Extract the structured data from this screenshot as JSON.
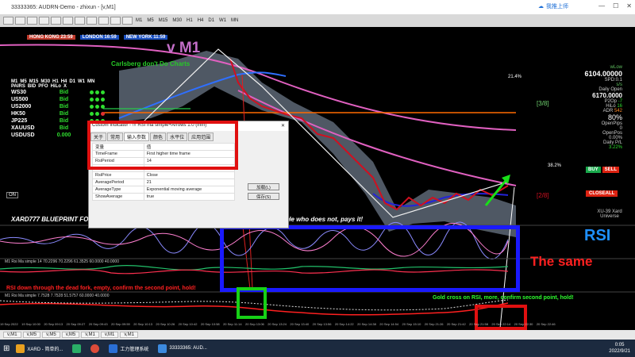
{
  "window": {
    "title": "33333365: AUDRN-Demo - zhixun - [v,M1]",
    "cloud_label": "我推上师"
  },
  "toolbar": {
    "timeframes": [
      "M1",
      "M5",
      "M15",
      "M30",
      "H1",
      "H4",
      "D1",
      "W1",
      "MN"
    ]
  },
  "sessions": [
    {
      "label": "HONG KONG 23:59"
    },
    {
      "label": "LONDON 16:59"
    },
    {
      "label": "NEW YORK 11:59"
    }
  ],
  "chart": {
    "overlay_title": "v M1",
    "carlsberg_text": "Carlsberg don't Do Charts",
    "blueprint_text": "XARD777 BLUEPRINT FOR SUCCESS  ROBWT  ONE INTEREST  He who orders it , earns it... He who does not, pays it!",
    "level_3_8": "[3/8]",
    "level_2_8": "[2/8]",
    "fib_21": "21.4%",
    "fib_38": "38.2%",
    "on_label": "ON",
    "rsi_label": "RSI",
    "same_label": "The same",
    "gold_label": "Gold cross on RSI, more, confirm second point, hold!",
    "down_label": "RSI down through the dead fork, empty, confirm the second point, hold!",
    "sub1_label": "M1 Rsi Ma simple 14 70.2296 70.2296 61.3525 60.0000 40.0000",
    "sub2_label": "M1 Rsi Ma simple 7.7528 7.7528 51.5757 60.0000 40.0000",
    "xard_universe": "XU-39 Xard Universe",
    "time_labels": [
      "19 Sep 2022",
      "19 Sep 10:00",
      "20 Sep 09:13",
      "20 Sep 09:27",
      "20 Sep 09:43",
      "20 Sep 09:59",
      "20 Sep 10:13",
      "20 Sep 10:26",
      "20 Sep 10:42",
      "20 Sep 10:58",
      "20 Sep 11:14",
      "20 Sep 13:06",
      "20 Sep 13:24",
      "20 Sep 13:40",
      "20 Sep 13:56",
      "20 Sep 14:22",
      "20 Sep 14:38",
      "20 Sep 14:54",
      "20 Sep 15:10",
      "20 Sep 21:26",
      "20 Sep 21:42",
      "20 Sep 21:58",
      "20 Sep 22:14",
      "20 Sep 22:30",
      "20 Sep 22:46"
    ]
  },
  "symbol_table": {
    "header": [
      "M1",
      "M5",
      "M15",
      "M30",
      "H1",
      "H4",
      "D1",
      "W1",
      "MN"
    ],
    "row_labels": [
      "PAIRS",
      "BID",
      "PFO",
      "HiLo",
      "X"
    ],
    "rows": [
      {
        "symbol": "WS30",
        "bid": "Bid"
      },
      {
        "symbol": "US500",
        "bid": "Bid"
      },
      {
        "symbol": "US2000",
        "bid": "Bid"
      },
      {
        "symbol": "HK50",
        "bid": "Bid"
      },
      {
        "symbol": "JP225",
        "bid": "Bid"
      },
      {
        "symbol": "XAUUSD",
        "bid": "Bid"
      },
      {
        "symbol": "USDUSD",
        "bid": "0.000"
      }
    ]
  },
  "right_panel": {
    "wlow": "wLow",
    "price": "6104.00000",
    "spd": "SPD:0.1",
    "spd2": "s/s",
    "daily_open_label": "Daily Open",
    "daily_open": "6170.0000",
    "p2op_label": "P2Op",
    "p2op": "-7",
    "hilo_label": "HiLo",
    "hilo": "16",
    "adr_label": "ADR",
    "adr": "542",
    "percent": "80%",
    "openpips_label": "OpenPips",
    "openpips": "0",
    "openpos_label": "OpenPos",
    "openpos": "0.00%",
    "daily_pl_label": "Daily P/L",
    "daily_pl": "3.22%",
    "buy": "BUY",
    "sell": "SELL",
    "closeall": "CLOSEALL"
  },
  "dialog": {
    "title": "Custom Indicator - !!! RSI ma simple+Arrows 1.0 (mm)",
    "tabs": [
      "关于",
      "常用",
      "输入参数",
      "颜色",
      "水平位",
      "应用范围"
    ],
    "columns": [
      "变量",
      "值"
    ],
    "params": [
      {
        "name": "TimeFrame",
        "value": "First higher time frame"
      },
      {
        "name": "RsiPeriod",
        "value": "14"
      },
      {
        "name": "",
        "value": ""
      },
      {
        "name": "RsiPrice",
        "value": "Close"
      },
      {
        "name": "AveragePeriod",
        "value": "21"
      },
      {
        "name": "AverageType",
        "value": "Exponential moving average"
      },
      {
        "name": "ShowAverage",
        "value": "true"
      }
    ],
    "load_btn": "加载(L)",
    "save_btn": "保存(S)"
  },
  "chart_tabs": [
    "v,M1",
    "v,M5",
    "v,M5",
    "v,M5",
    "v,M1",
    "v,M1",
    "v,M1"
  ],
  "taskbar": {
    "items": [
      "XARD - 简单的...",
      "",
      "",
      "工力管理系统",
      "33333365: AUD..."
    ],
    "time": "0:05",
    "date": "2022/9/21"
  },
  "colors": {
    "annotation_red": "#e01010",
    "annotation_blue": "#1a1aff",
    "annotation_green": "#17d117",
    "price_line": "#ff3366",
    "ma_pink": "#e060c0"
  }
}
